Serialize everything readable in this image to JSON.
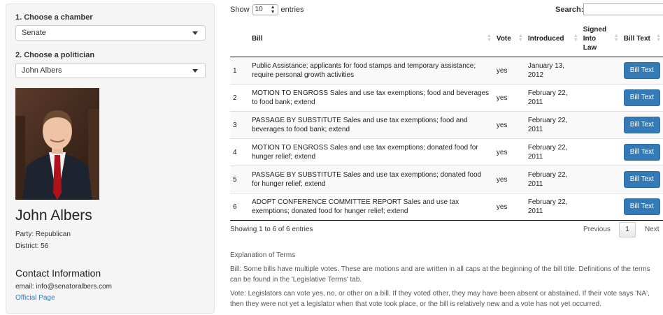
{
  "sidebar": {
    "chamber_label": "1. Choose a chamber",
    "chamber_value": "Senate",
    "politician_label": "2. Choose a politician",
    "politician_value": "John Albers",
    "name": "John Albers",
    "party": "Party: Republican",
    "district": "District: 56",
    "contact_heading": "Contact Information",
    "email": "email: info@senatoralbers.com",
    "official_link": "Official Page"
  },
  "table_controls": {
    "show_label": "Show",
    "page_length": "10",
    "entries_label": "entries",
    "search_label": "Search:",
    "search_value": ""
  },
  "table": {
    "columns": [
      "",
      "Bill",
      "Vote",
      "Introduced",
      "Signed Into Law",
      "Bill Text"
    ],
    "rows": [
      {
        "n": "1",
        "bill": "Public Assistance; applicants for food stamps and temporary assistance; require personal growth activities",
        "vote": "yes",
        "introduced": "January 13, 2012",
        "signed": "",
        "button": "Bill Text"
      },
      {
        "n": "2",
        "bill": "MOTION TO ENGROSS Sales and use tax exemptions; food and beverages to food bank; extend",
        "vote": "yes",
        "introduced": "February 22, 2011",
        "signed": "",
        "button": "Bill Text"
      },
      {
        "n": "3",
        "bill": "PASSAGE BY SUBSTITUTE Sales and use tax exemptions; food and beverages to food bank; extend",
        "vote": "yes",
        "introduced": "February 22, 2011",
        "signed": "",
        "button": "Bill Text"
      },
      {
        "n": "4",
        "bill": "MOTION TO ENGROSS Sales and use tax exemptions; donated food for hunger relief; extend",
        "vote": "yes",
        "introduced": "February 22, 2011",
        "signed": "",
        "button": "Bill Text"
      },
      {
        "n": "5",
        "bill": "PASSAGE BY SUBSTITUTE Sales and use tax exemptions; donated food for hunger relief; extend",
        "vote": "yes",
        "introduced": "February 22, 2011",
        "signed": "",
        "button": "Bill Text"
      },
      {
        "n": "6",
        "bill": "ADOPT CONFERENCE COMMITTEE REPORT Sales and use tax exemptions; donated food for hunger relief; extend",
        "vote": "yes",
        "introduced": "February 22, 2011",
        "signed": "",
        "button": "Bill Text"
      }
    ]
  },
  "pagination": {
    "info": "Showing 1 to 6 of 6 entries",
    "previous": "Previous",
    "current": "1",
    "next": "Next"
  },
  "explanation": {
    "heading": "Explanation of Terms",
    "bill": "Bill: Some bills have multiple votes. These are motions and are written in all caps at the beginning of the bill title. Definitions of the terms can be found in the 'Legislative Terms' tab.",
    "vote": "Vote: Legislators can vote yes, no, or other on a bill. If they voted other, they may have been absent or abstained. If their vote says 'NA', then they were not yet a legislator when that vote took place, or the bill is relatively new and a vote has not yet occurred."
  },
  "icons": {
    "dropdown": "caret-down-icon",
    "sort": "sort-arrows-icon",
    "spinner": "spinner-arrows-icon"
  },
  "colors": {
    "link": "#337ab7",
    "button": "#337ab7",
    "panel": "#f5f5f5"
  }
}
